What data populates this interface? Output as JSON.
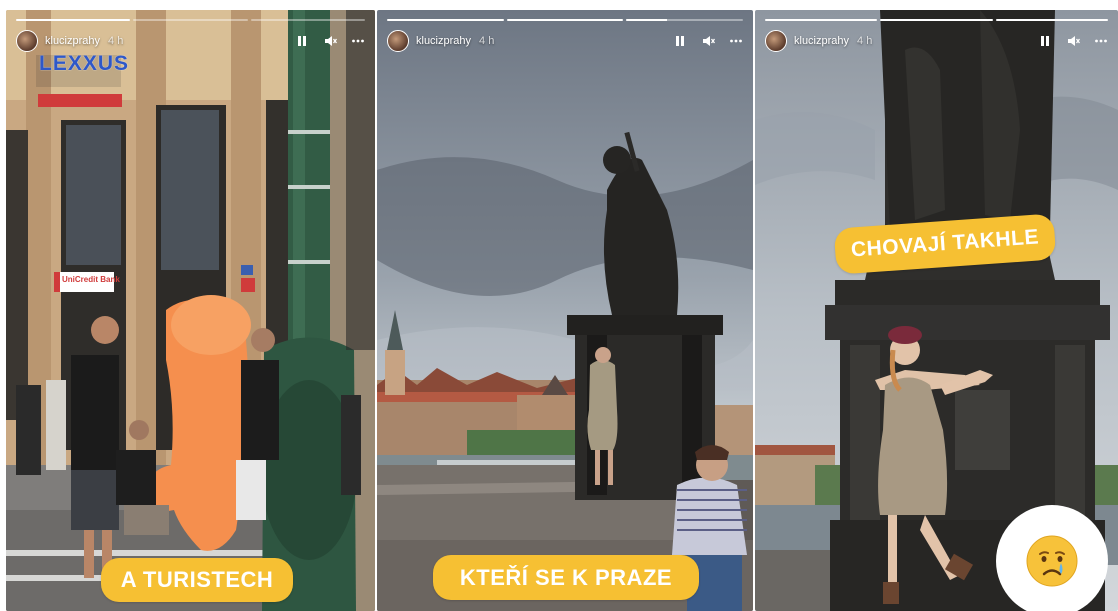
{
  "stories": [
    {
      "username": "klucizprahy",
      "time": "4 h",
      "progress": [
        1,
        0,
        0
      ],
      "sign_text": "LEXXUS",
      "bank_text": "UniCredit Bank",
      "caption": "A TURISTECH"
    },
    {
      "username": "klucizprahy",
      "time": "4 h",
      "progress": [
        1,
        1,
        0.35
      ],
      "caption": "KTEŘÍ SE K PRAZE"
    },
    {
      "username": "klucizprahy",
      "time": "4 h",
      "progress": [
        1,
        1,
        1
      ],
      "caption": "CHOVAJÍ TAKHLE",
      "sticker": "crying-face"
    }
  ],
  "colors": {
    "caption_bg": "#f6c033",
    "caption_text": "#ffffff"
  },
  "icons": [
    "pause-icon",
    "mute-icon",
    "more-icon",
    "crying-face-icon"
  ]
}
